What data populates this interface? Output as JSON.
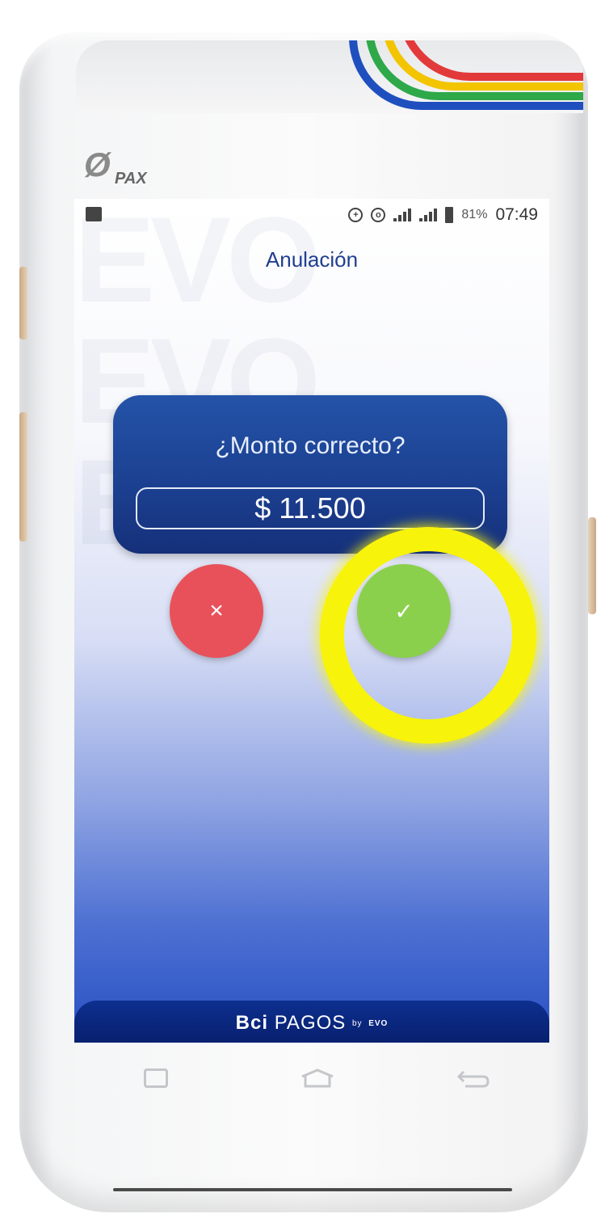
{
  "device": {
    "manufacturer_logo": "PAX",
    "top_brand": "Bci PAGOS"
  },
  "statusbar": {
    "battery_percent": "81%",
    "time": "07:49",
    "left_icon": "image-icon",
    "icons": [
      "data-saver-icon",
      "vpn-icon",
      "signal-icon",
      "signal-icon",
      "battery-icon"
    ]
  },
  "screen": {
    "title": "Anulación",
    "watermark": "EVO"
  },
  "dialog": {
    "question": "¿Monto correcto?",
    "amount": "$ 11.500"
  },
  "buttons": {
    "cancel_symbol": "×",
    "confirm_symbol": "✓",
    "cancel_color": "#e8515a",
    "confirm_color": "#8bd04c",
    "highlight_color": "#f8f30a"
  },
  "brand_bar": {
    "bci": "Bci",
    "pagos": "PAGOS",
    "by": "by",
    "evo": "EVO"
  }
}
